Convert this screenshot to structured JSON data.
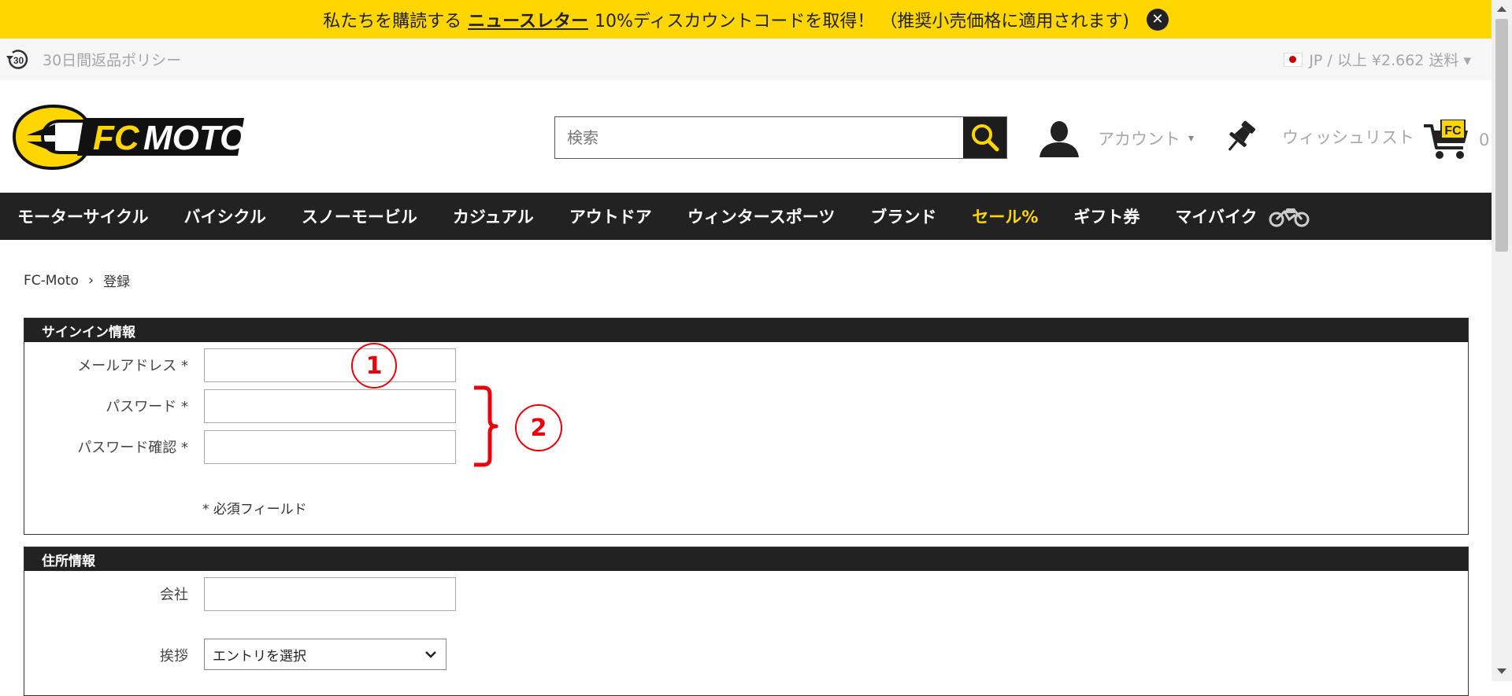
{
  "promo": {
    "prefix": "私たちを購読する",
    "link": "ニュースレター",
    "suffix": "10%ディスカウントコードを取得！ （推奨小売価格に適用されます)"
  },
  "utility": {
    "returns_badge": "30",
    "returns_label": "30日間返品ポリシー",
    "shipping": "JP / 以上 ¥2.662 送料 ▾"
  },
  "header": {
    "logo_text": "FC MOTO",
    "search_placeholder": "検索",
    "account_label": "アカウント",
    "account_caret": "▾",
    "wishlist_label": "ウィッシュリスト",
    "cart_badge": "FC",
    "cart_count": "0"
  },
  "nav": {
    "items": [
      "モーターサイクル",
      "バイシクル",
      "スノーモービル",
      "カジュアル",
      "アウトドア",
      "ウィンタースポーツ",
      "ブランド",
      "セール%",
      "ギフト券",
      "マイバイク"
    ]
  },
  "breadcrumb": {
    "home": "FC-Moto",
    "separator": "›",
    "current": "登録"
  },
  "signin_section": {
    "title": "サインイン情報",
    "email_label": "メールアドレス *",
    "password_label": "パスワード *",
    "password_confirm_label": "パスワード確認 *",
    "required_note": "* 必須フィールド"
  },
  "address_section": {
    "title": "住所情報",
    "company_label": "会社",
    "salutation_label": "挨拶",
    "salutation_value": "エントリを選択"
  },
  "annotations": {
    "marker_1": "1",
    "marker_2": "2"
  },
  "colors": {
    "brand_yellow": "#ffd600",
    "nav_bg": "#222222",
    "annotation_red": "#e8000b"
  }
}
